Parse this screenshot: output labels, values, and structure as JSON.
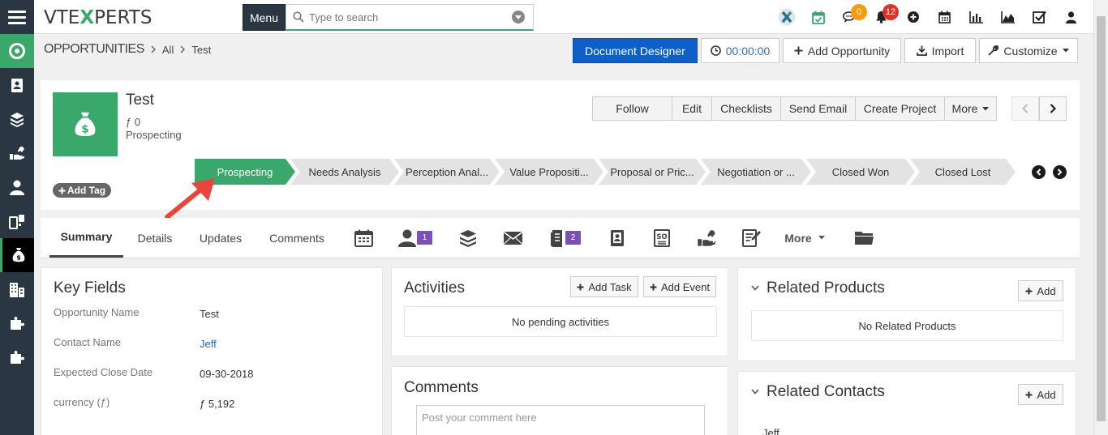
{
  "app": {
    "logo_pre": "VTE",
    "logo_x": "X",
    "logo_post": "PERTS",
    "menu_label": "Menu",
    "search_placeholder": "Type to search"
  },
  "notifications": {
    "chat_count": "0",
    "bell_count": "12",
    "chat_color": "#f39c12",
    "bell_color": "#d9342b"
  },
  "breadcrumb": {
    "module": "OPPORTUNITIES",
    "filter": "All",
    "record": "Test"
  },
  "header_buttons": {
    "document_designer": "Document Designer",
    "timer": "00:00:00",
    "add_opportunity": "Add Opportunity",
    "import": "Import",
    "customize": "Customize"
  },
  "record": {
    "title": "Test",
    "amount": "ƒ 0",
    "stage": "Prospecting",
    "add_tag": "Add Tag"
  },
  "actions": [
    "Follow",
    "Edit",
    "Checklists",
    "Send Email",
    "Create Project",
    "More"
  ],
  "stages": [
    "Prospecting",
    "Needs Analysis",
    "Perception Anal...",
    "Value Propositi...",
    "Proposal or Pric...",
    "Negotiation or ...",
    "Closed Won",
    "Closed Lost"
  ],
  "tabs": {
    "summary": "Summary",
    "details": "Details",
    "updates": "Updates",
    "comments": "Comments",
    "more": "More",
    "contacts_count": "1",
    "documents_count": "2"
  },
  "key_fields": {
    "title": "Key Fields",
    "rows": [
      {
        "label": "Opportunity Name",
        "value": "Test"
      },
      {
        "label": "Contact Name",
        "value": "Jeff"
      },
      {
        "label": "Expected Close Date",
        "value": "09-30-2018"
      },
      {
        "label": "currency (ƒ)",
        "value": "ƒ 5,192"
      }
    ]
  },
  "activities": {
    "title": "Activities",
    "add_task": "Add Task",
    "add_event": "Add Event",
    "empty": "No pending activities"
  },
  "comments": {
    "title": "Comments",
    "placeholder": "Post your comment here"
  },
  "related_products": {
    "title": "Related Products",
    "add": "Add",
    "empty": "No Related Products"
  },
  "related_contacts": {
    "title": "Related Contacts",
    "add": "Add",
    "first": "Jeff"
  },
  "colors": {
    "accent_green": "#3aa86b",
    "sidebar_dark": "#2a3642",
    "primary_blue": "#0f5fc9",
    "stage_grey": "#e3e3e3",
    "pointer_red": "#e8463c"
  }
}
